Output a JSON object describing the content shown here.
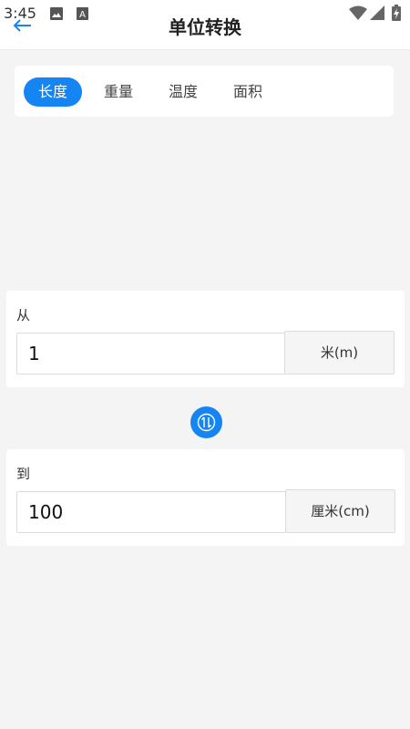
{
  "status_bar": {
    "time": "3:45",
    "icons": [
      "image-icon",
      "text-notification-icon",
      "wifi-icon",
      "signal-icon",
      "battery-charging-icon"
    ]
  },
  "header": {
    "title": "单位转换",
    "back_icon": "back-arrow-icon"
  },
  "tabs": [
    {
      "label": "长度",
      "active": true
    },
    {
      "label": "重量",
      "active": false
    },
    {
      "label": "温度",
      "active": false
    },
    {
      "label": "面积",
      "active": false
    }
  ],
  "from": {
    "label": "从",
    "value": "1",
    "unit": "米(m)"
  },
  "swap": {
    "icon": "swap-vertical-icon"
  },
  "to": {
    "label": "到",
    "value": "100",
    "unit": "厘米(cm)"
  },
  "colors": {
    "accent": "#1685f4",
    "background": "#f4f4f4",
    "card": "#ffffff"
  }
}
